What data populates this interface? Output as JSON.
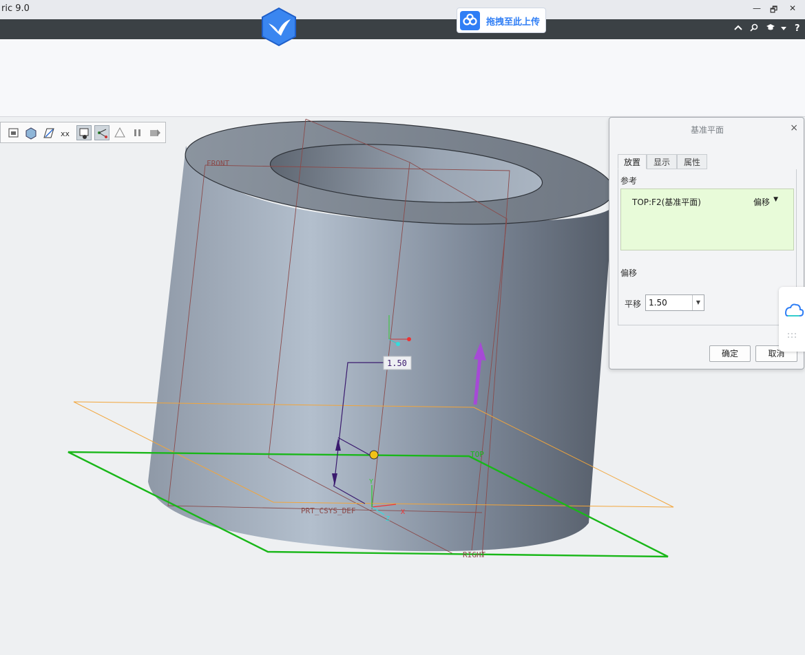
{
  "window": {
    "title": "ric 9.0",
    "controls": {
      "minimize": "—",
      "restore": "🗗",
      "close": "✕"
    }
  },
  "menubar": {
    "icons": [
      "chevron-up-icon",
      "search-icon",
      "graduation-cap-icon",
      "caret-down-icon",
      "help-icon"
    ],
    "help_label": "?"
  },
  "upload": {
    "label": "拖拽至此上传"
  },
  "graphics": {
    "datum_labels": {
      "front": "FRONT",
      "top": "TOP",
      "right": "RIGHT",
      "csys": "PRT_CSYS_DEF",
      "axis_x": "X",
      "axis_y": "Y",
      "axis_z": "Z"
    },
    "dimension": "1.50",
    "colors": {
      "top_plane": "#19b719",
      "new_plane": "#f2a53a",
      "datum_lines": "#8a4a4a",
      "drag_handle": "#a64ad6",
      "dimension": "#3a1a6e"
    }
  },
  "dialog": {
    "title": "基准平面",
    "close": "×",
    "tabs": [
      {
        "label": "放置",
        "active": true
      },
      {
        "label": "显示",
        "active": false
      },
      {
        "label": "属性",
        "active": false
      }
    ],
    "references_label": "参考",
    "reference": {
      "name": "TOP:F2(基准平面)",
      "constraint": "偏移"
    },
    "offset_section_label": "偏移",
    "translate_label": "平移",
    "translate_value": "1.50",
    "ok_label": "确定",
    "cancel_label": "取消"
  }
}
